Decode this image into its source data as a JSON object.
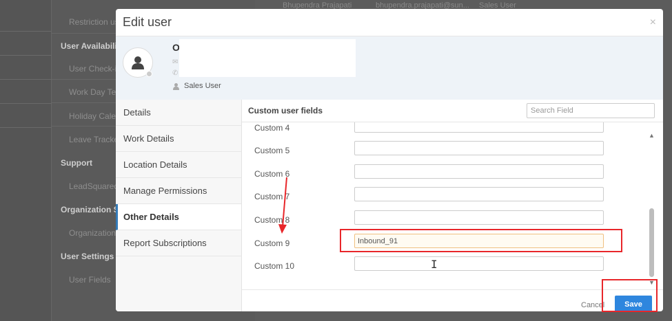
{
  "background": {
    "sidebar": {
      "items_top": [
        "Restriction us"
      ],
      "sections": [
        {
          "heading": "User Availability",
          "items": [
            "User Check-in",
            "Work Day Te",
            "Holiday Calen",
            "Leave Tracke"
          ]
        },
        {
          "heading": "Support",
          "items": [
            "LeadSquared"
          ]
        },
        {
          "heading": "Organization Sv",
          "items": [
            "Organization"
          ]
        },
        {
          "heading": "User Settings",
          "items": [
            "User Fields"
          ]
        }
      ]
    },
    "table_top_row": {
      "name": "Bhupendra Prajapati",
      "email": "bhupendra.prajapati@sun...",
      "role": "Sales User"
    }
  },
  "modal": {
    "title": "Edit user",
    "close_icon": "×",
    "profile": {
      "name_initial": "O",
      "role": "Sales User"
    },
    "nav": [
      {
        "label": "Details",
        "active": false
      },
      {
        "label": "Work Details",
        "active": false
      },
      {
        "label": "Location Details",
        "active": false
      },
      {
        "label": "Manage Permissions",
        "active": false
      },
      {
        "label": "Other Details",
        "active": true
      },
      {
        "label": "Report Subscriptions",
        "active": false
      }
    ],
    "content": {
      "title": "Custom user fields",
      "search_placeholder": "Search Field",
      "fields": [
        {
          "label": "Custom 4",
          "value": ""
        },
        {
          "label": "Custom 5",
          "value": ""
        },
        {
          "label": "Custom 6",
          "value": ""
        },
        {
          "label": "Custom 7",
          "value": ""
        },
        {
          "label": "Custom 8",
          "value": ""
        },
        {
          "label": "Custom 9",
          "value": "Inbound_91"
        },
        {
          "label": "Custom 10",
          "value": ""
        }
      ]
    },
    "footer": {
      "cancel_label": "Cancel",
      "save_label": "Save"
    }
  },
  "annotation_color": "#e8262a",
  "accent_color": "#2e86de"
}
